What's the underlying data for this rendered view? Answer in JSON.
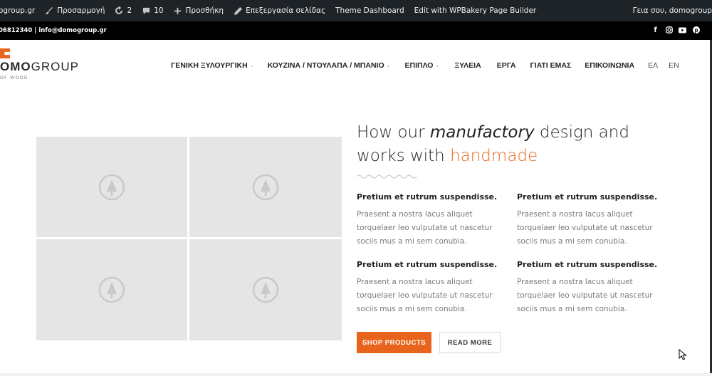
{
  "adminbar": {
    "site": "ogroup.gr",
    "customize": "Προσαρμογή",
    "updates": "2",
    "comments": "10",
    "add_new": "Προσθήκη",
    "edit_page": "Επεξεργασία σελίδας",
    "theme_dashboard": "Theme Dashboard",
    "wpbakery": "Edit with WPBakery Page Builder",
    "greeting": "Γεια σου, domogroup"
  },
  "topbar": {
    "contact": "06812340 | info@domogroup.gr",
    "social": [
      "facebook-icon",
      "instagram-icon",
      "youtube-icon",
      "pinterest-icon"
    ]
  },
  "logo": {
    "word_bold": "OMO",
    "word_light": "GROUP",
    "tagline": "OF WOOD"
  },
  "nav": {
    "items": [
      {
        "label": "ΓΕΝΙΚΗ ΞΥΛΟΥΡΓΙΚΗ",
        "has_dropdown": true
      },
      {
        "label": "ΚΟΥΖΙΝΑ / ΝΤΟΥΛΑΠΑ / ΜΠΑΝΙΟ",
        "has_dropdown": true
      },
      {
        "label": "ΕΠΙΠΛΟ",
        "has_dropdown": true
      },
      {
        "label": "ΞΥΛΕΙΑ",
        "has_dropdown": false
      },
      {
        "label": "ΕΡΓΑ",
        "has_dropdown": false
      },
      {
        "label": "ΓΙΑΤΙ ΕΜΑΣ",
        "has_dropdown": false
      },
      {
        "label": "ΕΠΙΚΟΙΝΩΝΙΑ",
        "has_dropdown": false
      }
    ],
    "lang_el": "ΕΛ",
    "lang_en": "EN"
  },
  "hero": {
    "line1_a": "How our ",
    "line1_em": "manufactory",
    "line1_b": " design and",
    "line2_a": "works with ",
    "line2_accent": "handmade"
  },
  "features": [
    {
      "title": "Pretium et rutrum suspendisse.",
      "lines": [
        "Praesent a nostra lacus aliquet",
        "torquelaer leo vulputate ut nascetur",
        "sociis mus a mi sem conubia."
      ]
    },
    {
      "title": "Pretium et rutrum suspendisse.",
      "lines": [
        "Praesent a nostra lacus aliquet",
        "torquelaer leo vulputate ut nascetur",
        "sociis mus a mi sem conubia."
      ]
    },
    {
      "title": "Pretium et rutrum suspendisse.",
      "lines": [
        "Praesent a nostra lacus aliquet",
        "torquelaer leo vulputate ut nascetur",
        "sociis mus a mi sem conubia."
      ]
    },
    {
      "title": "Pretium et rutrum suspendisse.",
      "lines": [
        "Praesent a nostra lacus aliquet",
        "torquelaer leo vulputate ut nascetur",
        "sociis mus a mi sem conubia."
      ]
    }
  ],
  "buttons": {
    "shop": "SHOP PRODUCTS",
    "read_more": "READ MORE"
  },
  "colors": {
    "accent": "#e8641c",
    "adminbar": "#1d2327",
    "topbar": "#000000",
    "placeholder": "#e5e5e5"
  }
}
